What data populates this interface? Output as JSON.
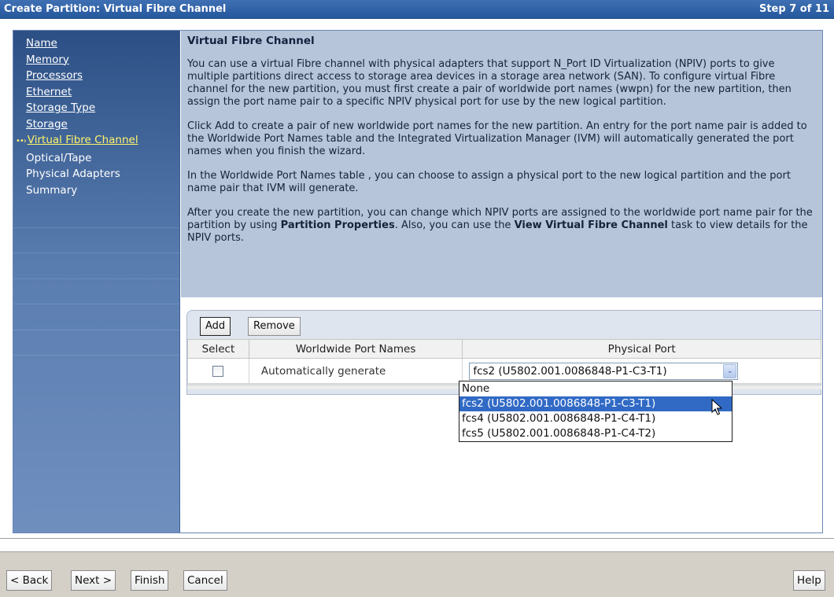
{
  "window": {
    "title": "Create Partition: Virtual Fibre Channel",
    "step": "Step 7 of 11"
  },
  "sidebar": {
    "items": [
      {
        "label": "Name",
        "state": "link"
      },
      {
        "label": "Memory",
        "state": "link"
      },
      {
        "label": "Processors",
        "state": "link"
      },
      {
        "label": "Ethernet",
        "state": "link"
      },
      {
        "label": "Storage Type",
        "state": "link"
      },
      {
        "label": "Storage",
        "state": "link"
      },
      {
        "label": "Virtual Fibre Channel",
        "state": "current"
      },
      {
        "label": "Optical/Tape",
        "state": "plain"
      },
      {
        "label": "Physical Adapters",
        "state": "plain"
      },
      {
        "label": "Summary",
        "state": "plain"
      }
    ],
    "current_marker": "••›"
  },
  "content": {
    "heading": "Virtual Fibre Channel",
    "paragraphs": {
      "p1": "You can use a virtual Fibre channel with physical adapters that support N_Port ID Virtualization (NPIV) ports to give multiple partitions direct access to storage area devices in a storage area network (SAN). To configure virtual Fibre channel for the new partition, you must first create a pair of worldwide port names (wwpn) for the new partition, then assign the port name pair to a specific NPIV physical port for use by the new logical partition.",
      "p2": "Click Add to create a pair of new worldwide port names for the new partition. An entry for the port name pair is added to the Worldwide Port Names table and the Integrated Virtualization Manager (IVM) will automatically generated the port names when you finish the wizard.",
      "p3": "In the Worldwide Port Names table , you can choose to assign a physical port to the new logical partition and the port name pair that IVM will generate.",
      "p4_a": "After you create the new partition, you can change which NPIV ports are assigned to the worldwide port name pair for the partition by using ",
      "p4_bold1": "Partition Properties",
      "p4_b": ". Also, you can use the ",
      "p4_bold2": "View Virtual Fibre Channel",
      "p4_c": " task to view details for the NPIV ports."
    }
  },
  "table": {
    "add_label": "Add",
    "remove_label": "Remove",
    "headers": {
      "select": "Select",
      "wwpn": "Worldwide Port Names",
      "port": "Physical Port"
    },
    "rows": [
      {
        "selected": false,
        "wwpn": "Automatically generate",
        "port": "fcs2 (U5802.001.0086848-P1-C3-T1)"
      }
    ],
    "dropdown_arrow": "⌄"
  },
  "dropdown": {
    "options": [
      "None",
      "fcs2 (U5802.001.0086848-P1-C3-T1)",
      "fcs4 (U5802.001.0086848-P1-C4-T1)",
      "fcs5 (U5802.001.0086848-P1-C4-T2)"
    ],
    "highlighted_index": 1
  },
  "footer": {
    "back_label": "< Back",
    "next_label": "Next >",
    "finish_label": "Finish",
    "cancel_label": "Cancel",
    "help_label": "Help"
  },
  "colors": {
    "titlebar": "#25579c",
    "sidebar_current": "#fff36b",
    "description_panel": "#b6c5da",
    "selection_highlight": "#316ac5"
  }
}
